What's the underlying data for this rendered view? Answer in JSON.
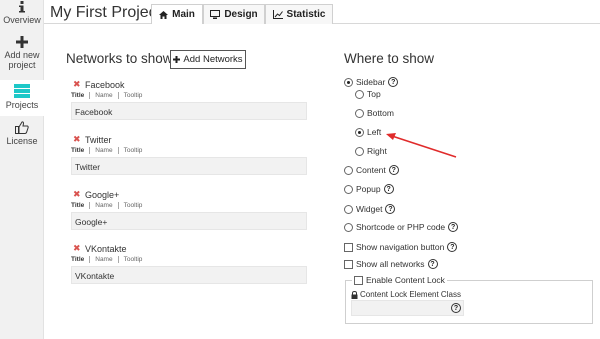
{
  "sidebar": {
    "items": [
      {
        "label": "Overview",
        "icon": "info-icon"
      },
      {
        "label": "Add new project",
        "label_line1": "Add new",
        "label_line2": "project",
        "icon": "plus-icon"
      },
      {
        "label": "Projects",
        "icon": "stack-icon"
      },
      {
        "label": "License",
        "icon": "thumbs-up-icon"
      }
    ],
    "active_color": "#1ec8c8"
  },
  "header": {
    "project_title": "My First Project",
    "tabs": [
      {
        "label": "Main",
        "icon": "home-icon",
        "active": true
      },
      {
        "label": "Design",
        "icon": "monitor-icon",
        "active": false
      },
      {
        "label": "Statistic",
        "icon": "chart-icon",
        "active": false
      }
    ]
  },
  "networks": {
    "title": "Networks to show",
    "add_button": "Add Networks",
    "tab_labels": {
      "title": "Title",
      "name": "Name",
      "tooltip": "Tooltip"
    },
    "items": [
      {
        "name": "Facebook",
        "value": "Facebook"
      },
      {
        "name": "Twitter",
        "value": "Twitter"
      },
      {
        "name": "Google+",
        "value": "Google+"
      },
      {
        "name": "VKontakte",
        "value": "VKontakte"
      }
    ],
    "remove_color": "#d9534f"
  },
  "where": {
    "title": "Where to show",
    "sidebar_option": "Sidebar",
    "sidebar_positions": [
      "Top",
      "Bottom",
      "Left",
      "Right"
    ],
    "selected_position": "Left",
    "options": [
      "Content",
      "Popup",
      "Widget",
      "Shortcode or PHP code"
    ],
    "show_navigation": "Show navigation button",
    "show_all": "Show all networks",
    "content_lock": "Enable Content Lock",
    "content_lock_class": "Content Lock Element Class",
    "help_glyph": "?",
    "arrow_color": "#e02b2b"
  }
}
